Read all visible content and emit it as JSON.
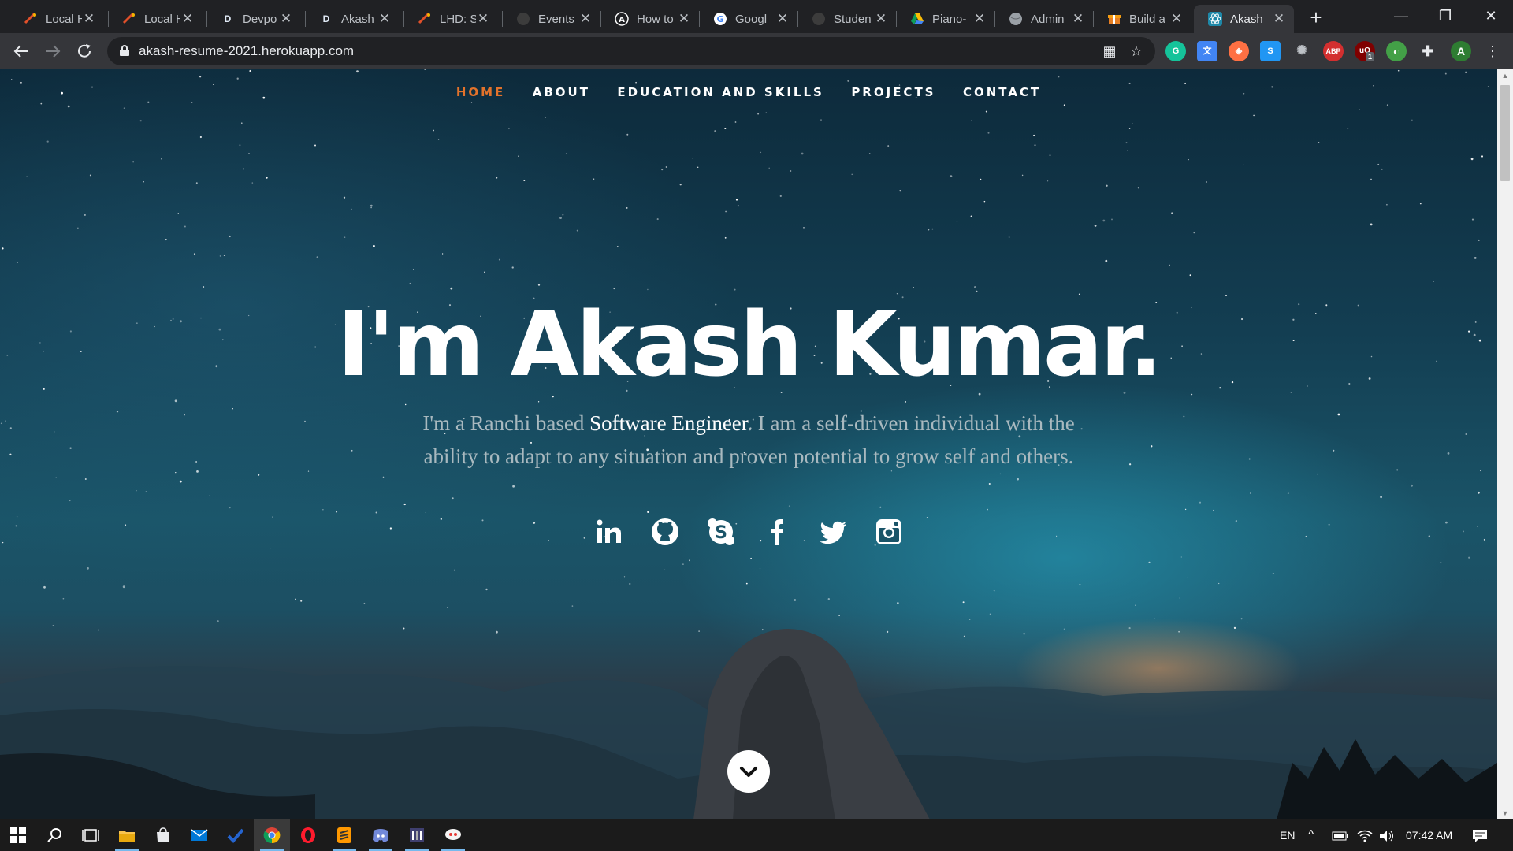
{
  "browser": {
    "tabs": [
      {
        "title": "Local H",
        "icon": "local-host-icon",
        "color": "#e0502a"
      },
      {
        "title": "Local H",
        "icon": "local-host-icon",
        "color": "#e0502a"
      },
      {
        "title": "Devpo",
        "icon": "devpost-icon",
        "color": "#dfe9f5"
      },
      {
        "title": "Akash",
        "icon": "devpost-icon",
        "color": "#dfe9f5"
      },
      {
        "title": "LHD: S",
        "icon": "local-host-icon",
        "color": "#e0502a"
      },
      {
        "title": "Events",
        "icon": "github-icon",
        "color": "#3c3c3c"
      },
      {
        "title": "How to",
        "icon": "a-logo-icon",
        "color": "#ffffff"
      },
      {
        "title": "Googl",
        "icon": "google-icon",
        "color": "#ffffff"
      },
      {
        "title": "Studen",
        "icon": "github-icon",
        "color": "#3c3c3c"
      },
      {
        "title": "Piano-",
        "icon": "google-drive-icon",
        "color": "#fbbc04"
      },
      {
        "title": "Admin",
        "icon": "globe-icon",
        "color": "#9aa0a6"
      },
      {
        "title": "Build a",
        "icon": "gift-icon",
        "color": "#e67e22"
      },
      {
        "title": "Akash",
        "icon": "react-icon",
        "color": "#61dafb",
        "active": true
      }
    ],
    "url": "akash-resume-2021.herokuapp.com",
    "extensions": [
      {
        "name": "grammarly-extension-icon",
        "label": "G",
        "color": "#15c39a"
      },
      {
        "name": "google-translate-extension-icon",
        "label": "文",
        "color": "#4285f4"
      },
      {
        "name": "extension-icon-3",
        "label": "◈",
        "color": "#ff7043"
      },
      {
        "name": "s-extension-icon",
        "label": "S",
        "color": "#2196f3"
      },
      {
        "name": "network-extension-icon",
        "label": "✺",
        "color": "#5f6368"
      },
      {
        "name": "adblock-plus-extension-icon",
        "label": "ABP",
        "color": "#d32f2f"
      },
      {
        "name": "ublock-extension-icon",
        "label": "uO",
        "color": "#800000",
        "badge": "1"
      },
      {
        "name": "extension-icon-8",
        "label": "◐",
        "color": "#43a047"
      },
      {
        "name": "extensions-puzzle-icon",
        "label": "✚",
        "color": "#35363a"
      }
    ],
    "profile_initial": "A"
  },
  "page": {
    "nav": [
      {
        "label": "HOME",
        "active": true
      },
      {
        "label": "ABOUT"
      },
      {
        "label": "EDUCATION AND SKILLS"
      },
      {
        "label": "PROJECTS"
      },
      {
        "label": "CONTACT"
      }
    ],
    "hero": {
      "title": "I'm Akash Kumar.",
      "text_before": "I'm a Ranchi based ",
      "text_highlight": "Software Engineer",
      "text_after": ". I am a self-driven individual with the ability to adapt to any situation and proven potential to grow self and others."
    },
    "social": [
      "linkedin-icon",
      "github-icon",
      "skype-icon",
      "facebook-icon",
      "twitter-icon",
      "instagram-icon"
    ],
    "accent_color": "#e2722b"
  },
  "taskbar": {
    "apps": [
      "file-explorer-icon",
      "store-icon",
      "mail-icon",
      "todo-icon",
      "chrome-icon",
      "opera-icon",
      "sublime-text-icon",
      "discord-icon",
      "app-icon",
      "chat-app-icon"
    ],
    "language": "EN",
    "time": "07:42 AM"
  }
}
